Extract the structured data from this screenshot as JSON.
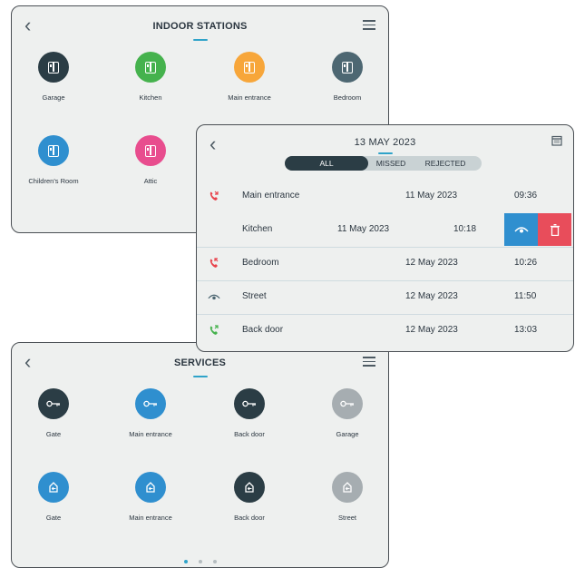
{
  "indoor": {
    "title": "INDOOR STATIONS",
    "items": [
      {
        "label": "Garage",
        "color": "#2b3d45"
      },
      {
        "label": "Kitchen",
        "color": "#45b24d"
      },
      {
        "label": "Main entrance",
        "color": "#f7a63a"
      },
      {
        "label": "Bedroom",
        "color": "#4d6772"
      },
      {
        "label": "Children's Room",
        "color": "#2f8fcf"
      },
      {
        "label": "Attic",
        "color": "#e84d8e"
      }
    ]
  },
  "log": {
    "title": "13 MAY 2023",
    "tabs": [
      "ALL",
      "MISSED",
      "REJECTED"
    ],
    "rows": [
      {
        "name": "Main entrance",
        "date": "11 May 2023",
        "time": "09:36",
        "icon": "missed-call-icon"
      },
      {
        "name": "Kitchen",
        "date": "11 May 2023",
        "time": "10:18",
        "icon": ""
      },
      {
        "name": "Bedroom",
        "date": "12 May 2023",
        "time": "10:26",
        "icon": "rejected-call-icon"
      },
      {
        "name": "Street",
        "date": "12 May 2023",
        "time": "11:50",
        "icon": "monitor-icon"
      },
      {
        "name": "Back door",
        "date": "12 May 2023",
        "time": "13:03",
        "icon": "answered-call-icon"
      }
    ],
    "colors": {
      "view": "#2f8fcf",
      "delete": "#e84d5b",
      "missed": "#e8414a",
      "answered": "#45b24d"
    }
  },
  "services": {
    "title": "SERVICES",
    "items": [
      {
        "label": "Gate",
        "type": "key",
        "color": "#2b3d45"
      },
      {
        "label": "Main entrance",
        "type": "key",
        "color": "#2f8fcf"
      },
      {
        "label": "Back door",
        "type": "key",
        "color": "#2b3d45"
      },
      {
        "label": "Garage",
        "type": "key",
        "color": "#a6adb1"
      },
      {
        "label": "Gate",
        "type": "door",
        "color": "#2f8fcf"
      },
      {
        "label": "Main entrance",
        "type": "door",
        "color": "#2f8fcf"
      },
      {
        "label": "Back door",
        "type": "door",
        "color": "#2b3d45"
      },
      {
        "label": "Street",
        "type": "door",
        "color": "#a6adb1"
      }
    ],
    "page_count": 3,
    "active_page": 1
  }
}
